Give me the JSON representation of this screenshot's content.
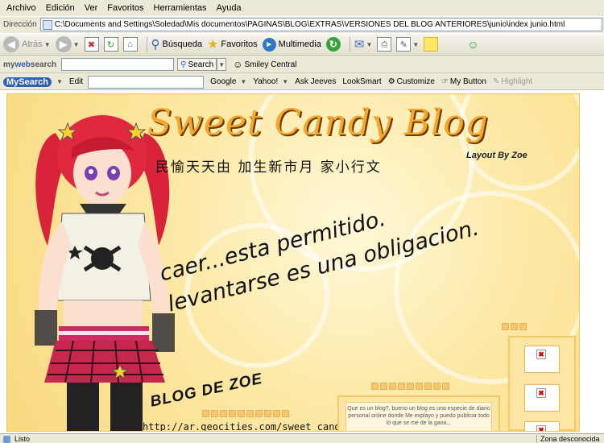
{
  "menubar": {
    "items": [
      "Archivo",
      "Edición",
      "Ver",
      "Favoritos",
      "Herramientas",
      "Ayuda"
    ]
  },
  "address": {
    "label": "Dirección",
    "url": "C:\\Documents and Settings\\Soledad\\Mis documentos\\PAGINAS\\BLOG\\EXTRAS\\VERSIONES DEL BLOG ANTERIORES\\junio\\index junio.html"
  },
  "toolbar": {
    "back_label": "Atrás",
    "search_label": "Búsqueda",
    "favorites_label": "Favoritos",
    "multimedia_label": "Multimedia"
  },
  "mywebsearch": {
    "brand_prefix": "my",
    "brand_web": "web",
    "brand_suffix": "search",
    "search_button": "Search",
    "smiley": "Smiley Central"
  },
  "mysearch": {
    "logo": "MySearch",
    "edit_label": "Edit",
    "items": [
      "Google",
      "Yahoo!",
      "Ask Jeeves",
      "LookSmart",
      "Customize",
      "My Button",
      "Highlight"
    ]
  },
  "page": {
    "title": "Sweet Candy Blog",
    "credit": "Layout By Zoe",
    "cjk": "民愉天天由 加生新市月 家小行文",
    "quote_line1": "caer...esta permitido.",
    "quote_line2": "levantarse es una obligacion.",
    "blog_name": "BLOG DE ZOE",
    "url": "http://ar.geocities.com/sweet_candy_blog",
    "intro_text": "Que es un blog?, bueno un blog es una especie de diario personal online donde Me explayo y puedo publicar todo lo que se me de la gana..."
  },
  "status": {
    "left": "Listo",
    "right": "Zona desconocida"
  },
  "colors": {
    "banner_bg": "#fde9a6",
    "title_orange": "#f6a62b",
    "chrome": "#ece9d8"
  }
}
